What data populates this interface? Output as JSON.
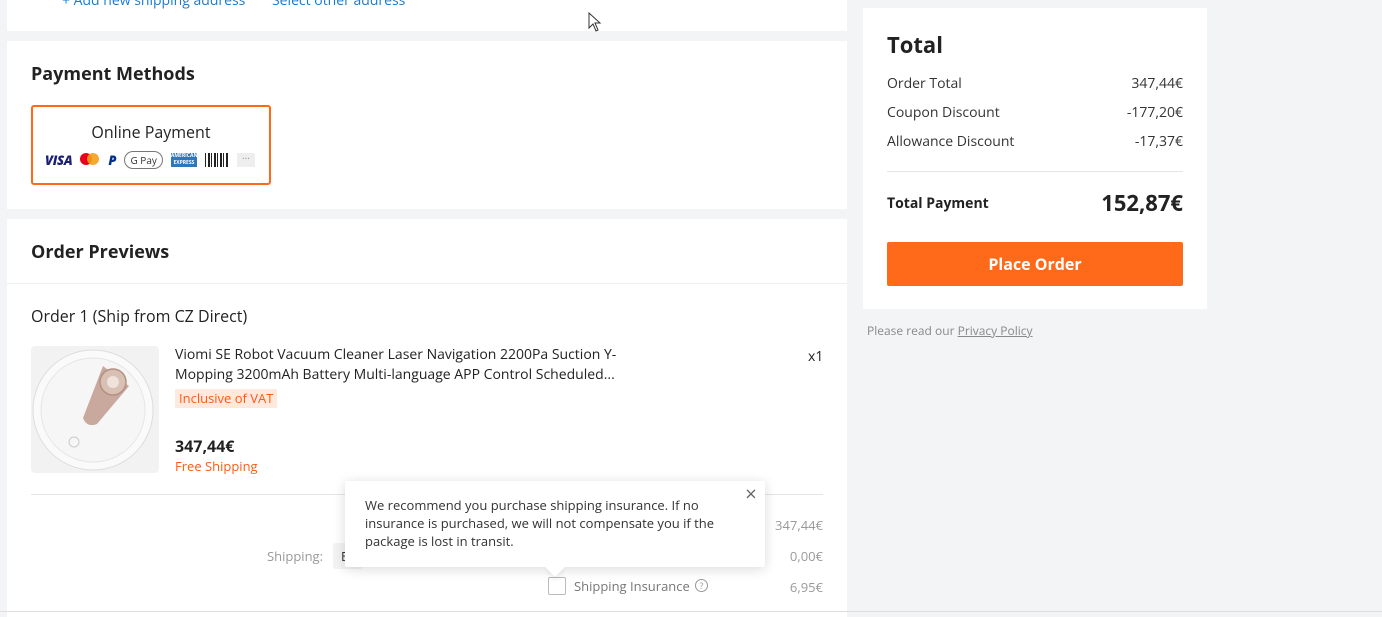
{
  "address": {
    "add_new": "+ Add new shipping address",
    "select_other": "Select other address"
  },
  "payment": {
    "title": "Payment Methods",
    "option_label": "Online Payment",
    "logos": [
      "visa-logo",
      "mastercard-logo",
      "paypal-logo",
      "google-pay-logo",
      "amex-logo",
      "boleto-logo",
      "more-icon"
    ],
    "logo_text": {
      "visa": "VISA",
      "gpay": "G Pay",
      "amex": "AMERICAN EXPRESS",
      "more": "···"
    }
  },
  "order_previews": {
    "title": "Order Previews",
    "order_heading": "Order 1 (Ship from CZ Direct)",
    "product": {
      "title": "Viomi SE Robot Vacuum Cleaner Laser Navigation 2200Pa Suction Y-Mopping 3200mAh Battery Multi-language APP Control Scheduled...",
      "vat_badge": "Inclusive of VAT",
      "quantity": "x1",
      "price": "347,44€",
      "shipping_note": "Free Shipping"
    },
    "subtotal": "347,44€",
    "shipping_label": "Shipping:",
    "shipping_method": "E",
    "shipping_cost": "0,00€",
    "insurance_label": "Shipping Insurance",
    "insurance_cost": "6,95€"
  },
  "tooltip": {
    "text": "We recommend you purchase shipping insurance. If no insurance is purchased, we will not compensate you if the package is lost in transit."
  },
  "summary": {
    "title": "Total",
    "rows": [
      {
        "label": "Order Total",
        "value": "347,44€"
      },
      {
        "label": "Coupon Discount",
        "value": "-177,20€"
      },
      {
        "label": "Allowance Discount",
        "value": "-17,37€"
      }
    ],
    "total_label": "Total Payment",
    "total_value": "152,87€",
    "place_order": "Place Order"
  },
  "privacy": {
    "prefix": "Please read our",
    "link": "Privacy Policy"
  },
  "colors": {
    "accent": "#ff6a1a",
    "link": "#1a7ad0",
    "background": "#f3f4f6"
  }
}
